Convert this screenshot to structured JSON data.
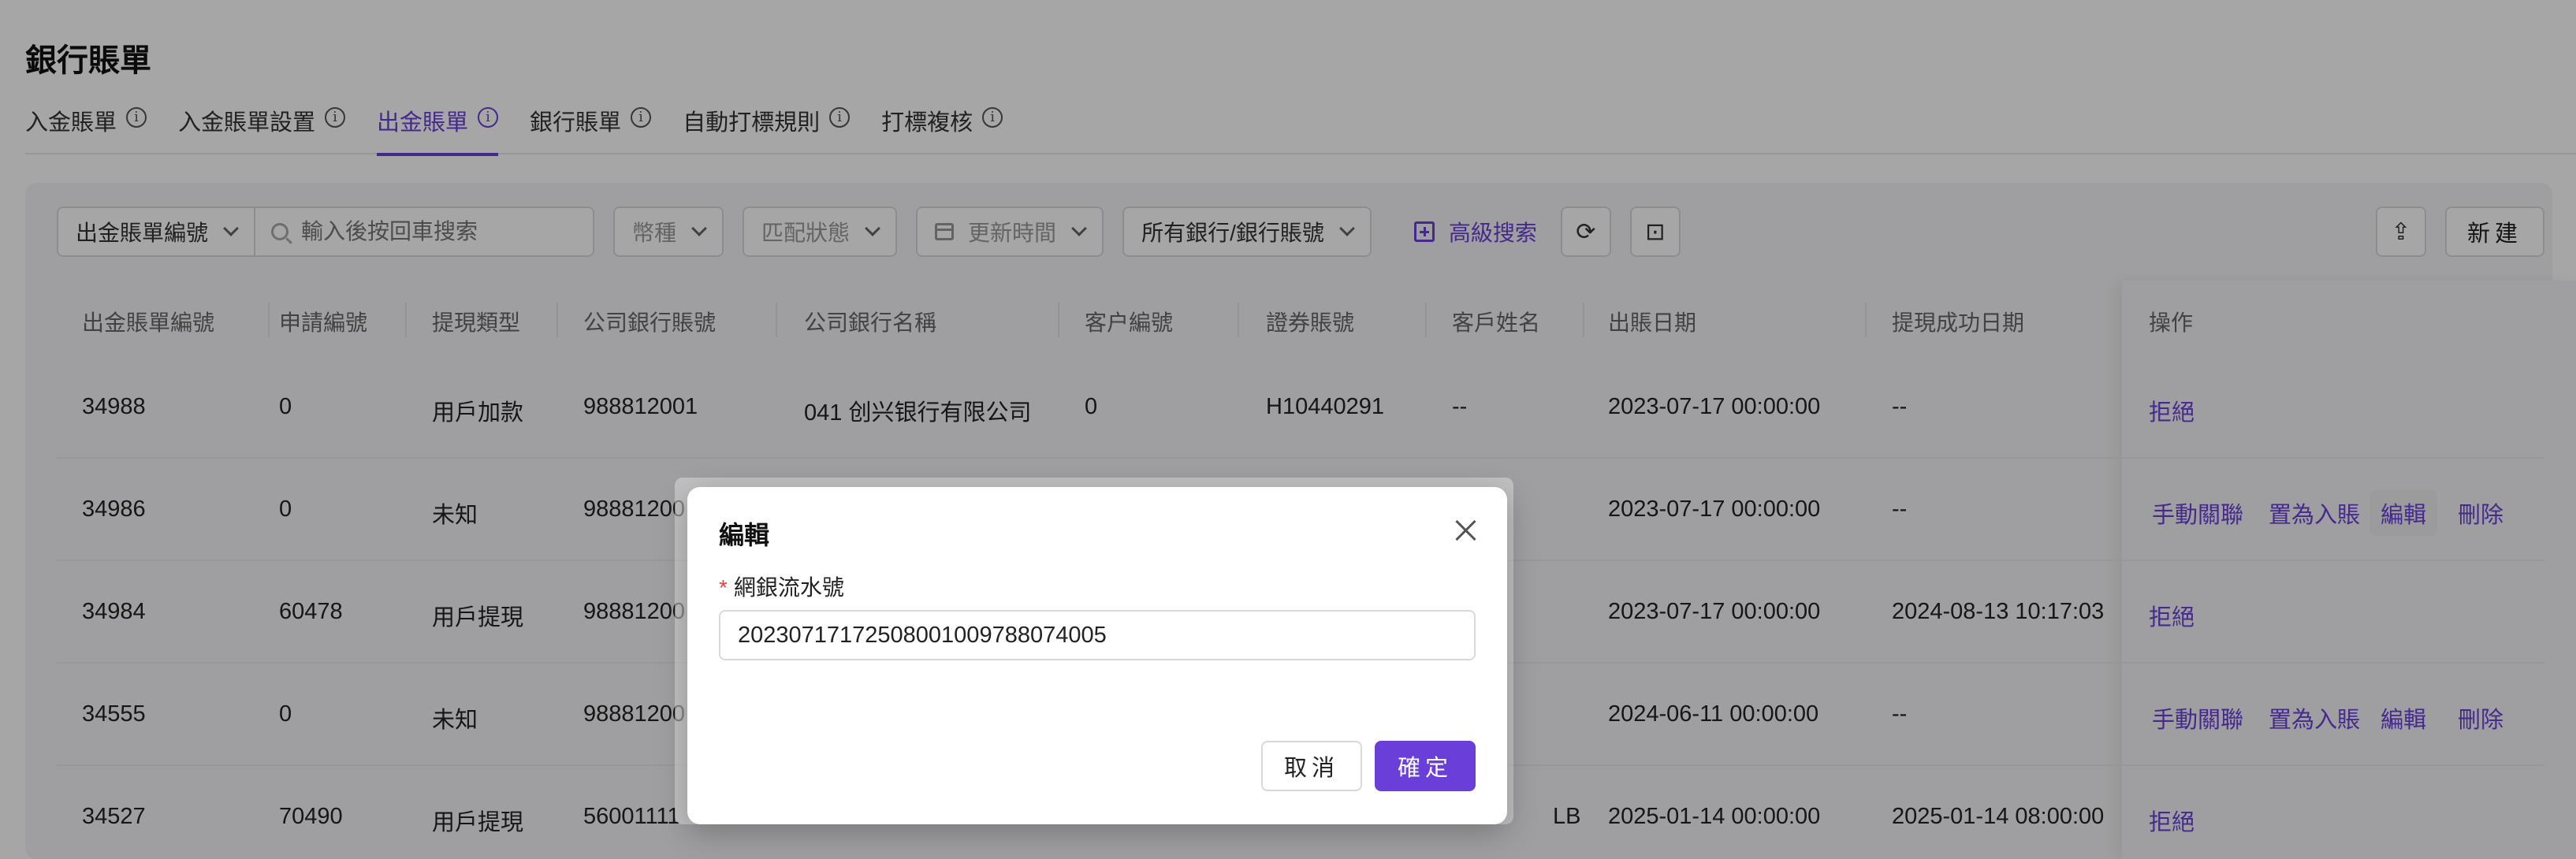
{
  "page_title": "銀行賬單",
  "tabs": [
    {
      "label": "入金賬單",
      "active": false
    },
    {
      "label": "入金賬單設置",
      "active": false
    },
    {
      "label": "出金賬單",
      "active": true
    },
    {
      "label": "銀行賬單",
      "active": false
    },
    {
      "label": "自動打標規則",
      "active": false
    },
    {
      "label": "打標複核",
      "active": false
    }
  ],
  "info_glyph": "i",
  "toolbar": {
    "search_field_select": "出金賬單編號",
    "search_placeholder": "輸入後按回車搜索",
    "currency_select": "幣種",
    "match_status_select": "匹配狀態",
    "update_time_select": "更新時間",
    "bank_account_select": "所有銀行/銀行賬號",
    "advanced_search": "高級搜索",
    "new_button": "新建"
  },
  "table": {
    "columns": [
      "出金賬單編號",
      "申請編號",
      "提現類型",
      "公司銀行賬號",
      "公司銀行名稱",
      "客户編號",
      "證券賬號",
      "客戶姓名",
      "出賬日期",
      "提現成功日期",
      "操作"
    ],
    "rows": [
      {
        "cells": [
          "34988",
          "0",
          "用戶加款",
          "988812001",
          "041 创兴银行有限公司",
          "0",
          "H10440291",
          "--",
          "2023-07-17 00:00:00",
          "--"
        ],
        "actions": [
          "拒絕"
        ]
      },
      {
        "cells": [
          "34986",
          "0",
          "未知",
          "98881200",
          "",
          "",
          "",
          "",
          "2023-07-17 00:00:00",
          "--"
        ],
        "actions": [
          "手動關聯",
          "置為入賬",
          "編輯",
          "刪除"
        ]
      },
      {
        "cells": [
          "34984",
          "60478",
          "用戶提現",
          "98881200",
          "",
          "",
          "",
          "",
          "2023-07-17 00:00:00",
          "2024-08-13 10:17:03"
        ],
        "actions": [
          "拒絕"
        ]
      },
      {
        "cells": [
          "34555",
          "0",
          "未知",
          "98881200",
          "",
          "",
          "",
          "",
          "2024-06-11 00:00:00",
          "--"
        ],
        "actions": [
          "手動關聯",
          "置為入賬",
          "編輯",
          "刪除"
        ]
      },
      {
        "cells": [
          "34527",
          "70490",
          "用戶提現",
          "56001111",
          "",
          "",
          "",
          "LB",
          "2025-01-14 00:00:00",
          "2025-01-14 08:00:00"
        ],
        "actions": [
          "拒絕"
        ]
      }
    ]
  },
  "modal": {
    "title": "編輯",
    "field_required_mark": "*",
    "field_label": "網銀流水號",
    "field_value": "20230717172508001009788074005",
    "cancel_label": "取消",
    "confirm_label": "確定"
  },
  "colors": {
    "accent": "#6a3fd9",
    "required": "#e54545"
  }
}
